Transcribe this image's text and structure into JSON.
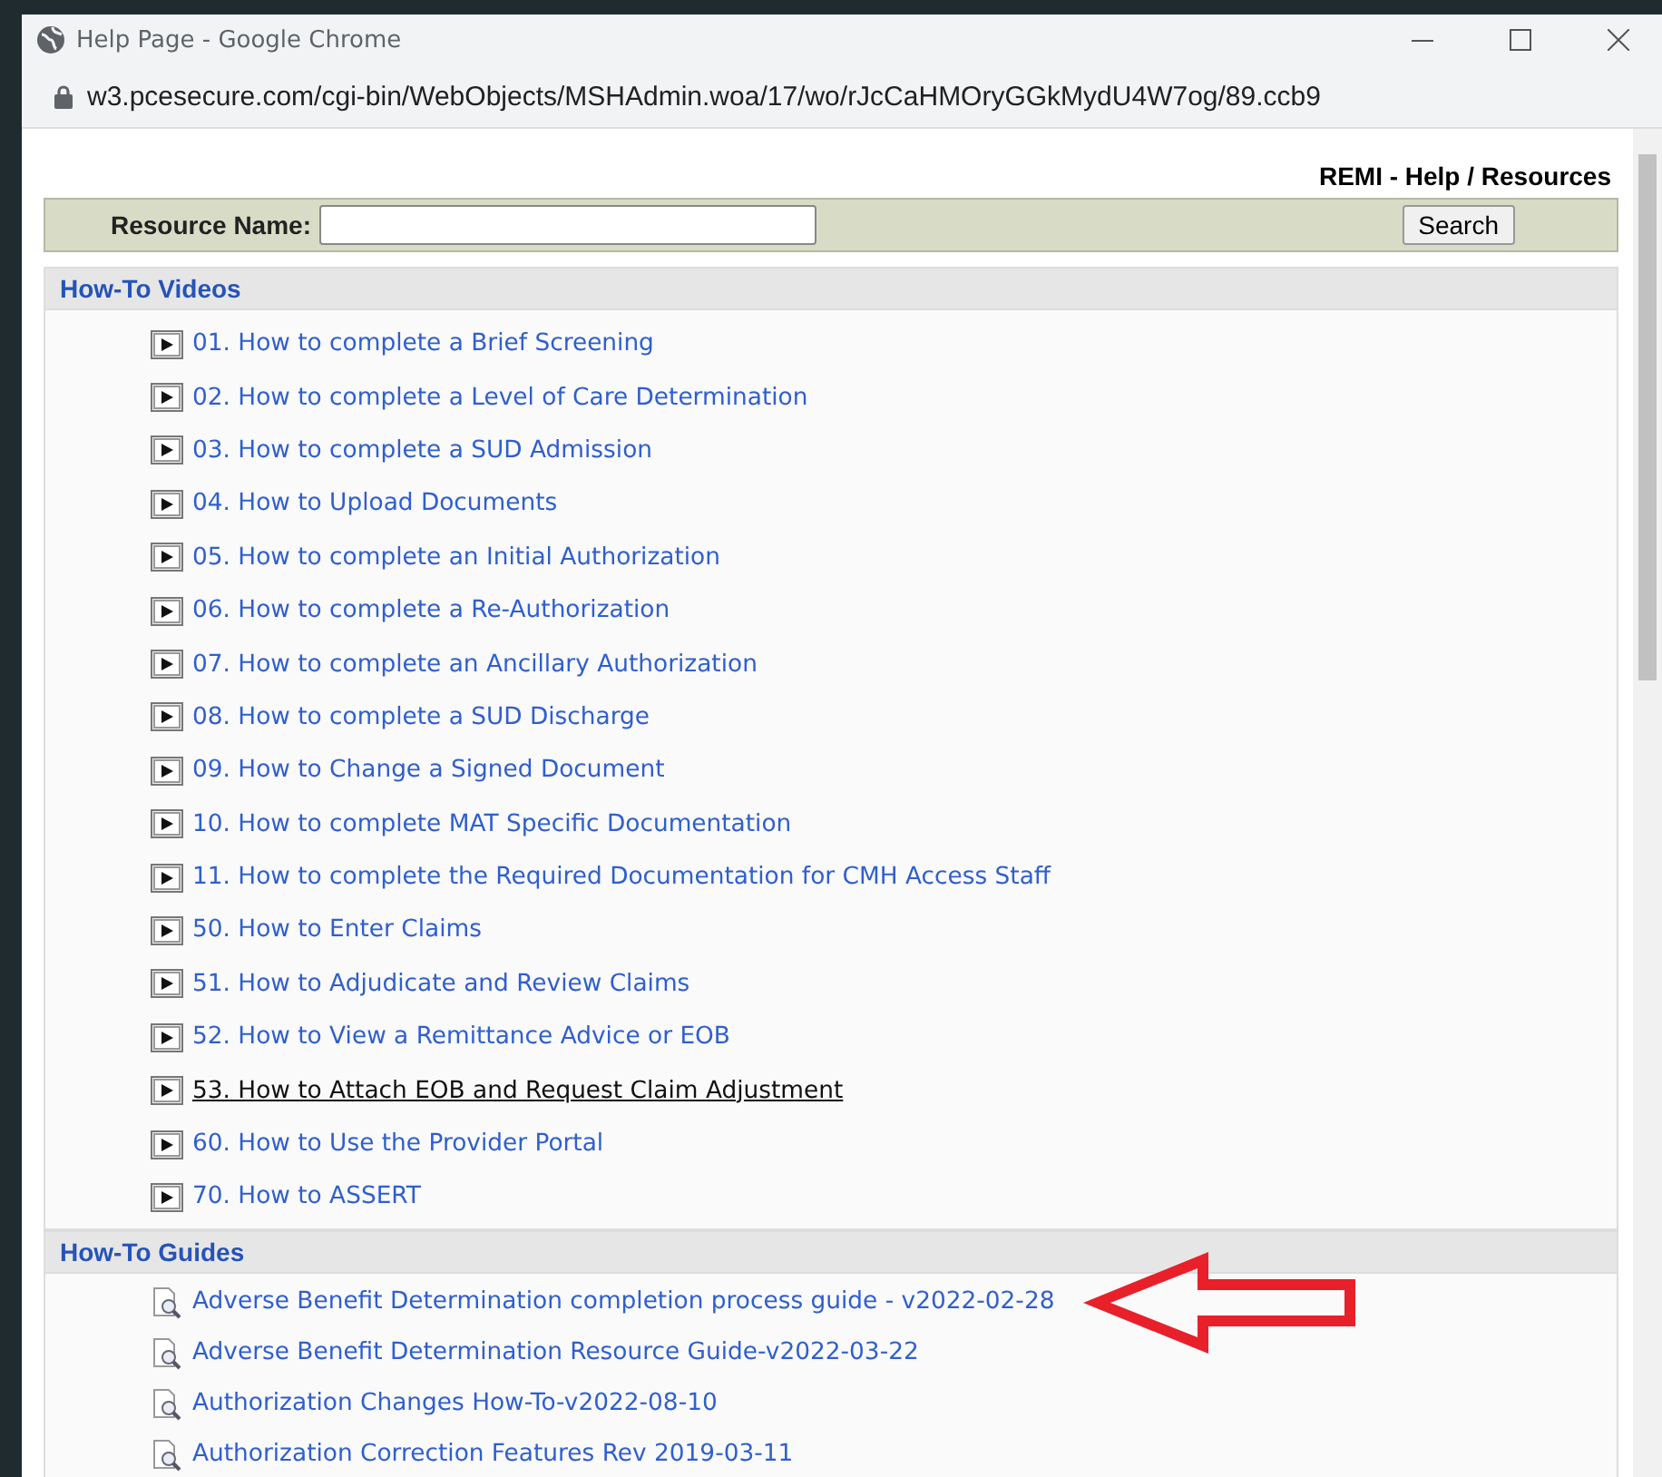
{
  "window": {
    "title": "Help Page - Google Chrome"
  },
  "address_bar": {
    "url": "w3.pcesecure.com/cgi-bin/WebObjects/MSHAdmin.woa/17/wo/rJcCaHMOryGGkMydU4W7og/89.ccb9"
  },
  "page": {
    "heading": "REMI - Help / Resources",
    "search": {
      "label": "Resource Name:",
      "button": "Search"
    },
    "sections": [
      {
        "title": "How-To Videos",
        "kind": "video",
        "items": [
          {
            "label": "01. How to complete a Brief Screening",
            "hovered": false
          },
          {
            "label": "02. How to complete a Level of Care Determination",
            "hovered": false
          },
          {
            "label": "03. How to complete a SUD Admission",
            "hovered": false
          },
          {
            "label": "04. How to Upload Documents",
            "hovered": false
          },
          {
            "label": "05. How to complete an Initial Authorization",
            "hovered": false
          },
          {
            "label": "06. How to complete a Re-Authorization",
            "hovered": false
          },
          {
            "label": "07. How to complete an Ancillary Authorization",
            "hovered": false
          },
          {
            "label": "08. How to complete a SUD Discharge",
            "hovered": false
          },
          {
            "label": "09. How to Change a Signed Document",
            "hovered": false
          },
          {
            "label": "10. How to complete MAT Specific Documentation",
            "hovered": false
          },
          {
            "label": "11. How to complete the Required Documentation for CMH Access Staff",
            "hovered": false
          },
          {
            "label": "50. How to Enter Claims",
            "hovered": false
          },
          {
            "label": "51. How to Adjudicate and Review Claims",
            "hovered": false
          },
          {
            "label": "52. How to View a Remittance Advice or EOB",
            "hovered": false
          },
          {
            "label": "53. How to Attach EOB and Request Claim Adjustment",
            "hovered": true
          },
          {
            "label": "60. How to Use the Provider Portal",
            "hovered": false
          },
          {
            "label": "70. How to ASSERT",
            "hovered": false
          }
        ]
      },
      {
        "title": "How-To Guides",
        "kind": "guide",
        "items": [
          {
            "label": "Adverse Benefit Determination completion process guide - v2022-02-28",
            "hovered": false,
            "annotated": true
          },
          {
            "label": "Adverse Benefit Determination Resource Guide-v2022-03-22",
            "hovered": false,
            "annotated": false
          },
          {
            "label": "Authorization Changes How-To-v2022-08-10",
            "hovered": false,
            "annotated": false
          },
          {
            "label": "Authorization Correction Features Rev 2019-03-11",
            "hovered": false,
            "annotated": false
          }
        ]
      }
    ]
  }
}
